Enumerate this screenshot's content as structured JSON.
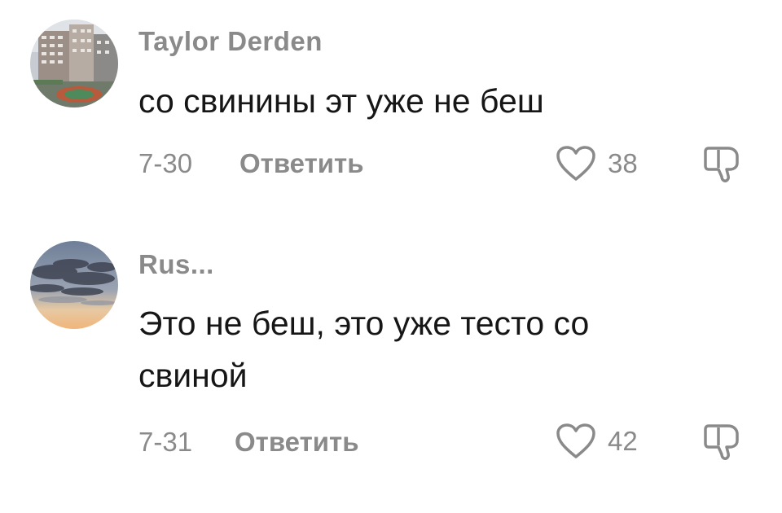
{
  "comments": [
    {
      "username": "Taylor Derden",
      "text": "со свинины эт уже не беш",
      "date": "7-30",
      "reply_label": "Ответить",
      "likes": "38",
      "avatar_icon": "building-photo-avatar"
    },
    {
      "username": "Rus...",
      "text": "Это не беш, это уже тесто со свиной",
      "date": "7-31",
      "reply_label": "Ответить",
      "likes": "42",
      "avatar_icon": "sky-photo-avatar"
    }
  ],
  "colors": {
    "secondary_text": "#8a8a8a",
    "primary_text": "#161616",
    "background": "#ffffff"
  }
}
